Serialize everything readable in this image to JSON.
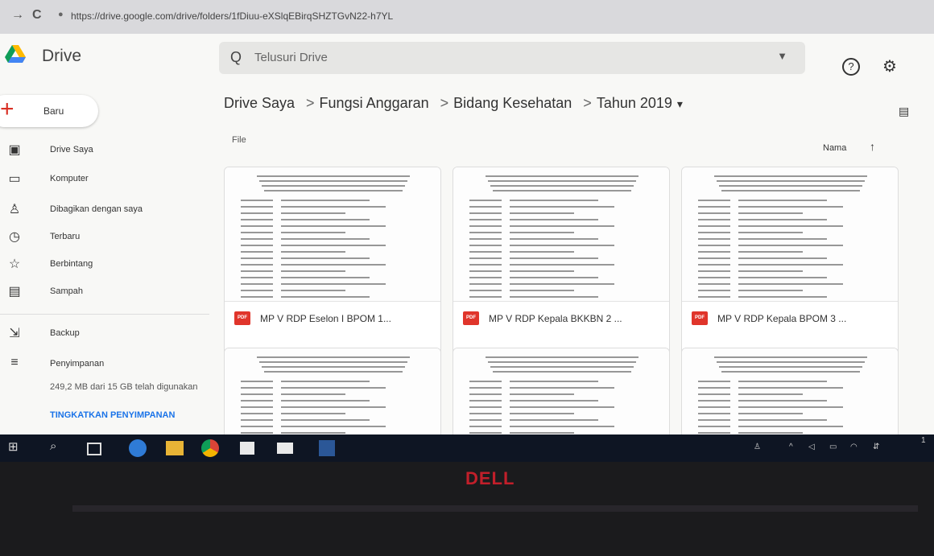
{
  "browser": {
    "back": "→",
    "reload": "C",
    "lock": "●",
    "url": "https://drive.google.com/drive/folders/1fDiuu-eXSlqEBirqSHZTGvN22-h7YL"
  },
  "app": {
    "title": "Drive",
    "search_placeholder": "Telusuri Drive",
    "search_icon": "Q",
    "search_caret": "▼",
    "help_icon": "?",
    "settings_icon": "⚙"
  },
  "new_button": {
    "plus": "+",
    "label": "Baru"
  },
  "sidebar": {
    "items": [
      {
        "icon": "▣",
        "label": "Drive Saya"
      },
      {
        "icon": "▭",
        "label": "Komputer"
      },
      {
        "icon": "♙",
        "label": "Dibagikan dengan saya"
      },
      {
        "icon": "◷",
        "label": "Terbaru"
      },
      {
        "icon": "☆",
        "label": "Berbintang"
      },
      {
        "icon": "▤",
        "label": "Sampah"
      },
      {
        "icon": "⇲",
        "label": "Backup"
      },
      {
        "icon": "≡",
        "label": "Penyimpanan"
      }
    ],
    "storage_text": "249,2 MB dari 15 GB telah digunakan",
    "upgrade": "TINGKATKAN PENYIMPANAN"
  },
  "breadcrumb": {
    "items": [
      "Drive Saya",
      "Fungsi Anggaran",
      "Bidang Kesehatan",
      "Tahun 2019"
    ],
    "separator": ">",
    "caret": "▾",
    "view_icon": "▤"
  },
  "files": {
    "section_label": "File",
    "sort_label": "Nama",
    "sort_arrow": "↑",
    "pdf_label": "PDF",
    "items": [
      {
        "name": "MP V RDP Eselon I BPOM 1..."
      },
      {
        "name": "MP V RDP Kepala BKKBN 2 ..."
      },
      {
        "name": "MP V RDP Kepala BPOM 3 ..."
      },
      {
        "name": ""
      },
      {
        "name": ""
      },
      {
        "name": ""
      }
    ]
  },
  "taskbar": {
    "start": "⊞",
    "search": "⌕",
    "tray_time": "1"
  },
  "bezel": {
    "logo": "DELL"
  },
  "colors": {
    "accent": "#1a73e8",
    "pdf": "#e0352b",
    "new_plus": "#d93025"
  }
}
